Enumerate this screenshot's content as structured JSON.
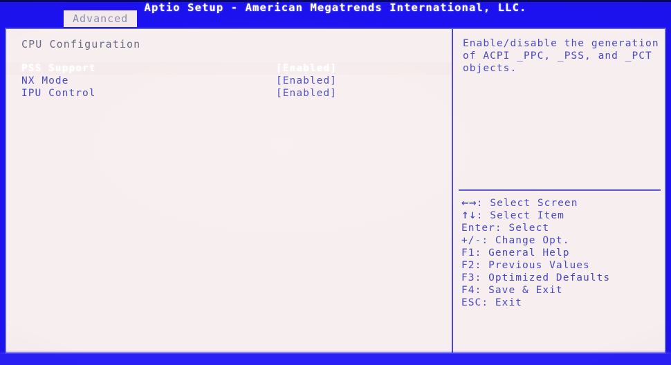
{
  "window": {
    "title": "Aptio Setup - American Megatrends International, LLC."
  },
  "tabs": [
    {
      "label": "Advanced",
      "active": true
    }
  ],
  "main": {
    "section_title": "CPU Configuration",
    "options": [
      {
        "label": "PSS Support",
        "value": "[Enabled]",
        "selected": true
      },
      {
        "label": "NX Mode",
        "value": "[Enabled]",
        "selected": false
      },
      {
        "label": "IPU Control",
        "value": "[Enabled]",
        "selected": false
      }
    ]
  },
  "help": {
    "text": "Enable/disable the generation of ACPI _PPC, _PSS, and _PCT objects."
  },
  "key_legend": [
    {
      "keys": "←→",
      "sep": ": ",
      "action": "Select Screen"
    },
    {
      "keys": "↑↓",
      "sep": ": ",
      "action": "Select Item"
    },
    {
      "keys": "Enter",
      "sep": ": ",
      "action": "Select"
    },
    {
      "keys": "+/-",
      "sep": ": ",
      "action": "Change Opt."
    },
    {
      "keys": "F1",
      "sep": ": ",
      "action": "General Help"
    },
    {
      "keys": "F2",
      "sep": ": ",
      "action": "Previous Values"
    },
    {
      "keys": "F3",
      "sep": ": ",
      "action": "Optimized Defaults"
    },
    {
      "keys": "F4",
      "sep": ": ",
      "action": "Save & Exit"
    },
    {
      "keys": "ESC",
      "sep": ": ",
      "action": "Exit"
    }
  ],
  "colors": {
    "header_blue": "#1c12ef",
    "panel_bg": "#f7eeef",
    "text_blue": "#4a4ac2",
    "border": "#5a5cd8",
    "selected_text": "#ffffff"
  }
}
